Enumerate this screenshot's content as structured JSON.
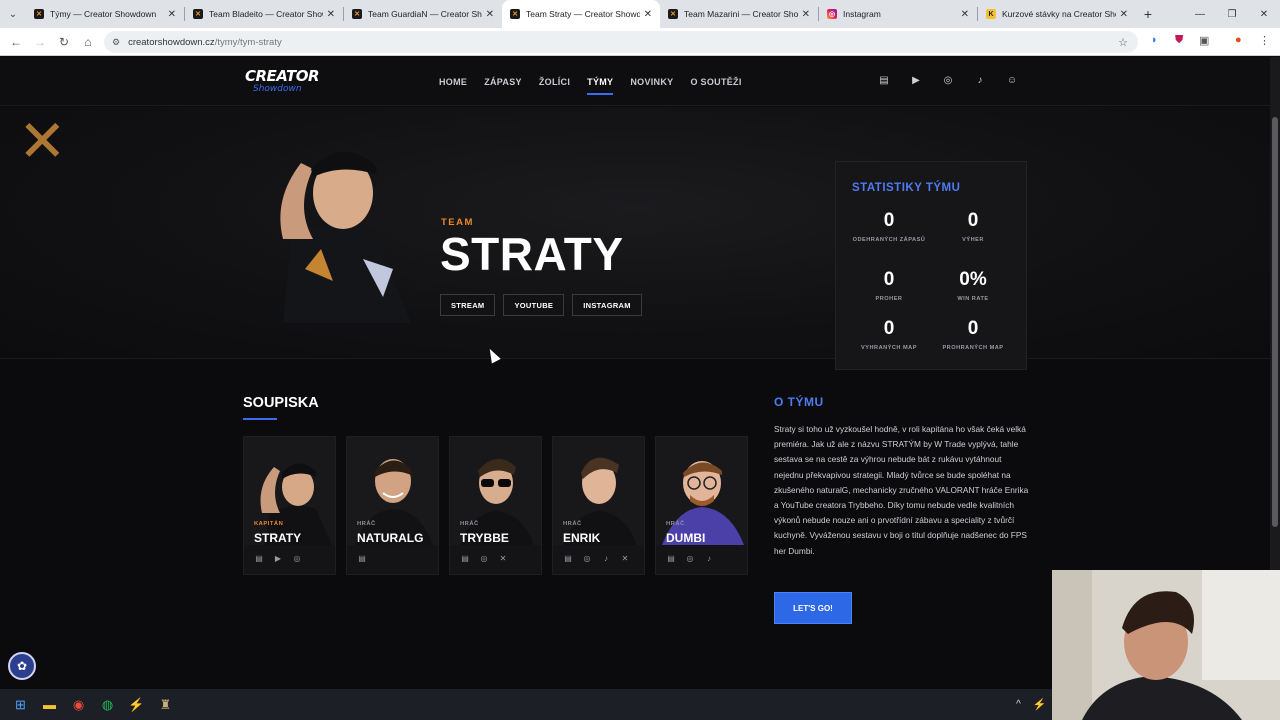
{
  "browser": {
    "tabs": [
      {
        "title": "Týmy — Creator Showdown",
        "icon": "cs-favicon",
        "active": false
      },
      {
        "title": "Team Bladeito — Creator Showdown",
        "icon": "cs-favicon",
        "active": false
      },
      {
        "title": "Team GuardiaN — Creator Showdown",
        "icon": "cs-favicon",
        "active": false
      },
      {
        "title": "Team Straty — Creator Showdown",
        "icon": "cs-favicon",
        "active": true
      },
      {
        "title": "Team Mazarini — Creator Showdown",
        "icon": "cs-favicon",
        "active": false
      },
      {
        "title": "Instagram",
        "icon": "instagram-favicon",
        "active": false
      },
      {
        "title": "Kurzové stávky na Creator Showdown",
        "icon": "kurzy-favicon",
        "active": false
      }
    ],
    "url_host": "creatorshowdown.cz",
    "url_path": "/tymy/tym-straty"
  },
  "site": {
    "logo_line1": "CREATOR",
    "logo_line2": "Showdown",
    "nav": [
      {
        "label": "HOME",
        "active": false
      },
      {
        "label": "ZÁPASY",
        "active": false
      },
      {
        "label": "ŽOLÍCI",
        "active": false
      },
      {
        "label": "TÝMY",
        "active": true
      },
      {
        "label": "NOVINKY",
        "active": false
      },
      {
        "label": "O SOUTĚŽI",
        "active": false
      }
    ],
    "socials": [
      "twitch-icon",
      "youtube-icon",
      "instagram-icon",
      "tiktok-icon",
      "discord-icon"
    ]
  },
  "hero": {
    "kicker": "TEAM",
    "team_name": "STRATY",
    "buttons": [
      "STREAM",
      "YOUTUBE",
      "INSTAGRAM"
    ]
  },
  "stats": {
    "title": "STATISTIKY TÝMU",
    "items": [
      {
        "value": "0",
        "label": "ODEHRANÝCH ZÁPASŮ"
      },
      {
        "value": "0",
        "label": "VÝHER"
      },
      {
        "value": "0",
        "label": "PROHER"
      },
      {
        "value": "0%",
        "label": "WIN RATE"
      },
      {
        "value": "0",
        "label": "VYHRANÝCH MAP"
      },
      {
        "value": "0",
        "label": "PROHRANÝCH MAP"
      }
    ]
  },
  "roster": {
    "title": "SOUPISKA",
    "players": [
      {
        "role": "KAPITÁN",
        "name": "STRATY",
        "icons": [
          "twitch-icon",
          "youtube-icon",
          "instagram-icon"
        ]
      },
      {
        "role": "HRÁČ",
        "name": "NATURALG",
        "icons": [
          "twitch-icon"
        ]
      },
      {
        "role": "HRÁČ",
        "name": "TRYBBE",
        "icons": [
          "twitch-icon",
          "instagram-icon",
          "x-icon"
        ]
      },
      {
        "role": "HRÁČ",
        "name": "ENRIK",
        "icons": [
          "twitch-icon",
          "instagram-icon",
          "tiktok-icon",
          "x-icon"
        ]
      },
      {
        "role": "HRÁČ",
        "name": "DUMBI",
        "icons": [
          "twitch-icon",
          "instagram-icon",
          "tiktok-icon"
        ]
      }
    ]
  },
  "about": {
    "title": "O TÝMU",
    "text": "Straty si toho už vyzkoušel hodně, v roli kapitána ho však čeká velká premiéra. Jak už ale z názvu STRATÝM by W Trade vyplývá, tahle sestava se na cestě za výhrou nebude bát z rukávu vytáhnout nejednu překvapivou strategii. Mladý tvůrce se bude spoléhat na zkušeného naturalG, mechanicky zručného VALORANT hráče Enrika a YouTube creatora Trybbeho. Díky tomu nebude vedle kvalitních výkonů nebude nouze ani o prvotřídní zábavu a speciality z tvůrčí kuchyně. Vyváženou sestavu v boji o titul doplňuje nadšenec do FPS her Dumbi.",
    "cta": "LET'S GO!"
  },
  "colors": {
    "accent_blue": "#3b6cf0",
    "accent_orange": "#e98a2b",
    "background": "#0b0b0d"
  }
}
